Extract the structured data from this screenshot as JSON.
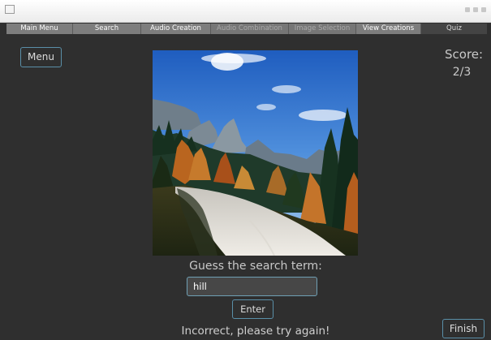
{
  "window": {
    "app_icon": "window-app-icon",
    "controls": [
      "minimize-icon",
      "maximize-icon",
      "close-icon"
    ]
  },
  "tabs": [
    {
      "label": "Main Menu",
      "state": "normal"
    },
    {
      "label": "Search",
      "state": "normal"
    },
    {
      "label": "Audio Creation",
      "state": "normal"
    },
    {
      "label": "Audio Combination",
      "state": "disabled"
    },
    {
      "label": "Image Selection",
      "state": "disabled"
    },
    {
      "label": "View Creations",
      "state": "normal"
    },
    {
      "label": "Quiz",
      "state": "active"
    }
  ],
  "quiz": {
    "menu_label": "Menu",
    "score_label": "Score:",
    "score_value": "2/3",
    "prompt": "Guess the search term:",
    "guess_value": "hill",
    "enter_label": "Enter",
    "feedback": "Incorrect, please try again!",
    "finish_label": "Finish",
    "image": "mountain-road-photo"
  },
  "colors": {
    "background": "#2f2f2f",
    "button_border": "#5a8fa8",
    "input_border": "#6f9fb4",
    "tab_active": "#444444"
  }
}
